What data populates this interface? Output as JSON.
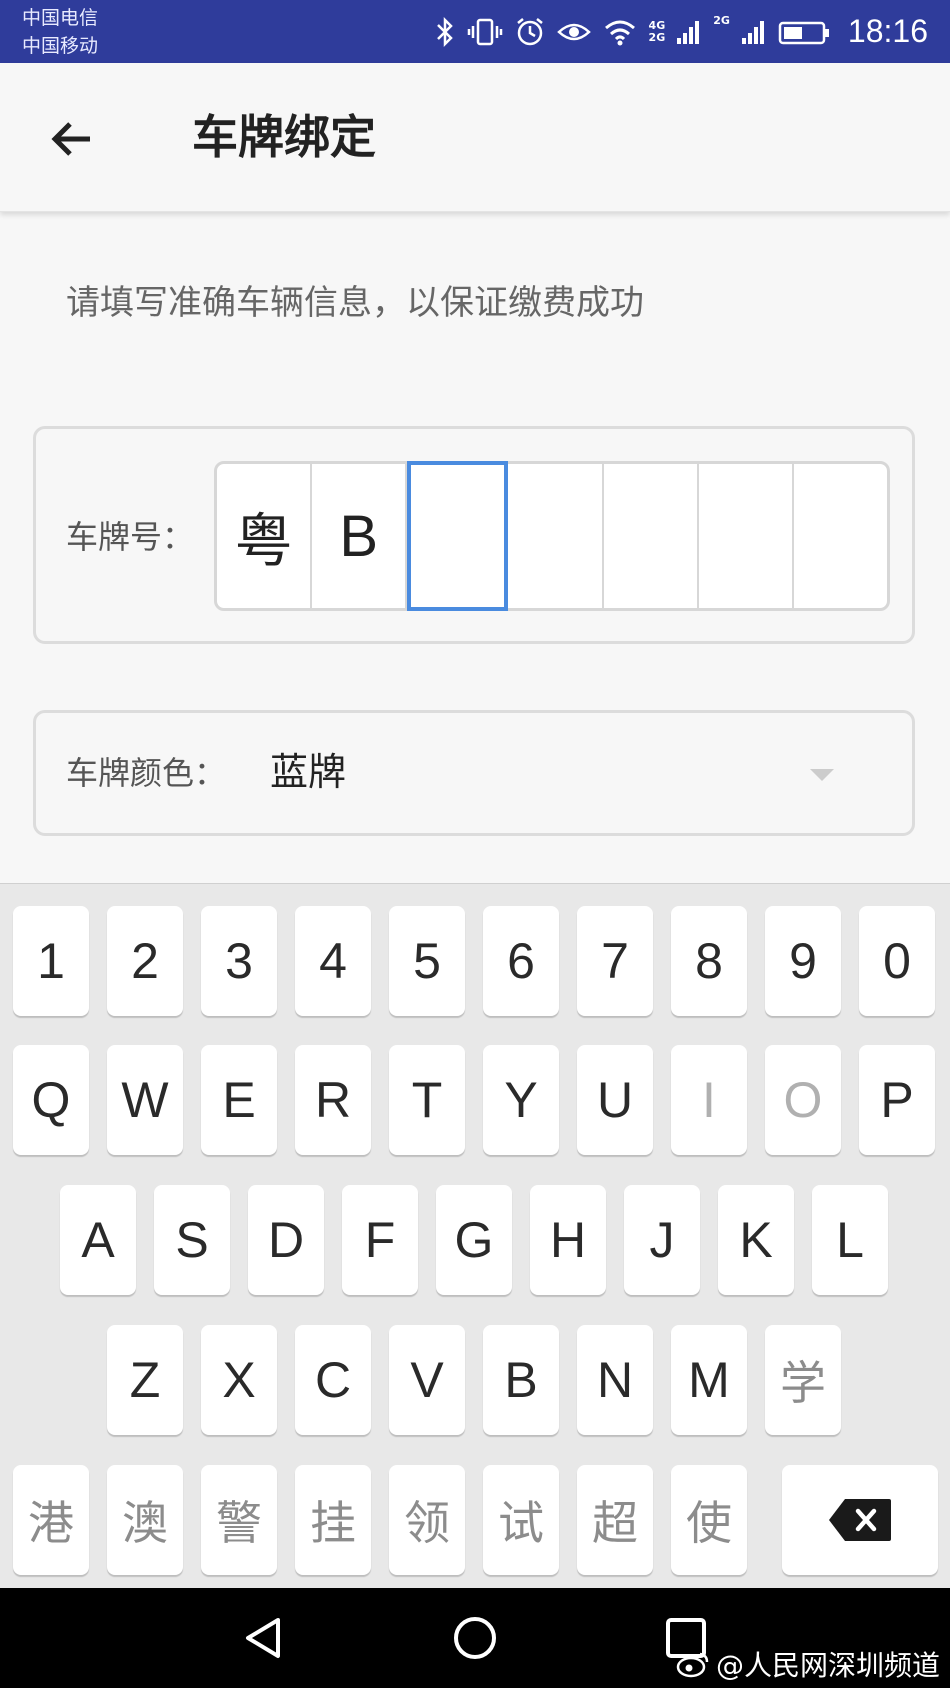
{
  "status_bar": {
    "carrier_1": "中国电信",
    "carrier_2": "中国移动",
    "network_1": "4G",
    "network_1b": "2G",
    "network_2": "2G",
    "time": "18:16",
    "icons": [
      "bluetooth-icon",
      "vibrate-icon",
      "alarm-icon",
      "eye-icon",
      "wifi-icon",
      "signal-icon",
      "signal-icon",
      "battery-icon"
    ]
  },
  "app_bar": {
    "title": "车牌绑定",
    "back_icon": "arrow-left-icon"
  },
  "hint": "请填写准确车辆信息，以保证缴费成功",
  "plate": {
    "label": "车牌号：",
    "cells": [
      "粤",
      "B",
      "",
      "",
      "",
      "",
      ""
    ],
    "active_index": 2
  },
  "plate_color": {
    "label": "车牌颜色：",
    "value": "蓝牌"
  },
  "keyboard": {
    "row1": [
      "1",
      "2",
      "3",
      "4",
      "5",
      "6",
      "7",
      "8",
      "9",
      "0"
    ],
    "row2": [
      "Q",
      "W",
      "E",
      "R",
      "T",
      "Y",
      "U",
      "I",
      "O",
      "P"
    ],
    "row2_disabled": [
      "I",
      "O"
    ],
    "row3": [
      "A",
      "S",
      "D",
      "F",
      "G",
      "H",
      "J",
      "K",
      "L"
    ],
    "row4": [
      "Z",
      "X",
      "C",
      "V",
      "B",
      "N",
      "M",
      "学"
    ],
    "row5": [
      "港",
      "澳",
      "警",
      "挂",
      "领",
      "试",
      "超",
      "使"
    ],
    "delete_icon": "backspace-icon"
  },
  "nav_bar": {
    "icons": [
      "back-triangle-icon",
      "home-circle-icon",
      "recent-square-icon"
    ]
  },
  "watermark": "@人民网深圳频道",
  "colors": {
    "status_bar": "#2f3c9b",
    "active_border": "#4a8bdf",
    "background": "#f7f7f7",
    "keyboard_bg": "#e8e8e8"
  }
}
